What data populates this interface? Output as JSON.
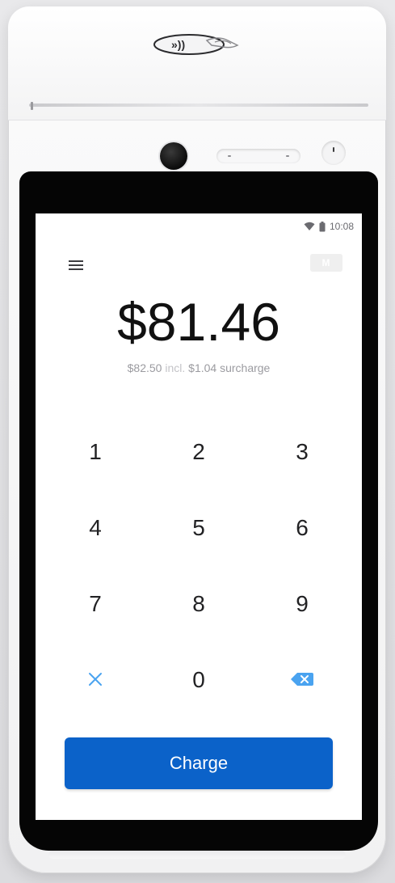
{
  "status_bar": {
    "time": "10:08",
    "icons": [
      "wifi-icon",
      "battery-icon"
    ]
  },
  "header": {
    "menu_icon": "hamburger-menu-icon",
    "merchant_badge": "M"
  },
  "payment": {
    "amount": "$81.46",
    "subtotal": "$82.50",
    "incl_word": "incl.",
    "surcharge": "$1.04 surcharge"
  },
  "keypad": {
    "keys": [
      {
        "label": "1",
        "type": "digit"
      },
      {
        "label": "2",
        "type": "digit"
      },
      {
        "label": "3",
        "type": "digit"
      },
      {
        "label": "4",
        "type": "digit"
      },
      {
        "label": "5",
        "type": "digit"
      },
      {
        "label": "6",
        "type": "digit"
      },
      {
        "label": "7",
        "type": "digit"
      },
      {
        "label": "8",
        "type": "digit"
      },
      {
        "label": "9",
        "type": "digit"
      },
      {
        "label": "",
        "type": "clear",
        "icon": "close-icon"
      },
      {
        "label": "0",
        "type": "digit"
      },
      {
        "label": "",
        "type": "backspace",
        "icon": "backspace-icon"
      }
    ]
  },
  "actions": {
    "charge_label": "Charge"
  },
  "colors": {
    "accent": "#0b62c9",
    "key_icon": "#4aa3f0",
    "amount_text": "#111111",
    "muted_text": "#9b9ba0"
  },
  "device": {
    "icons": [
      "contactless-icon",
      "camera-icon",
      "speaker-icon",
      "sensor-icon"
    ]
  }
}
